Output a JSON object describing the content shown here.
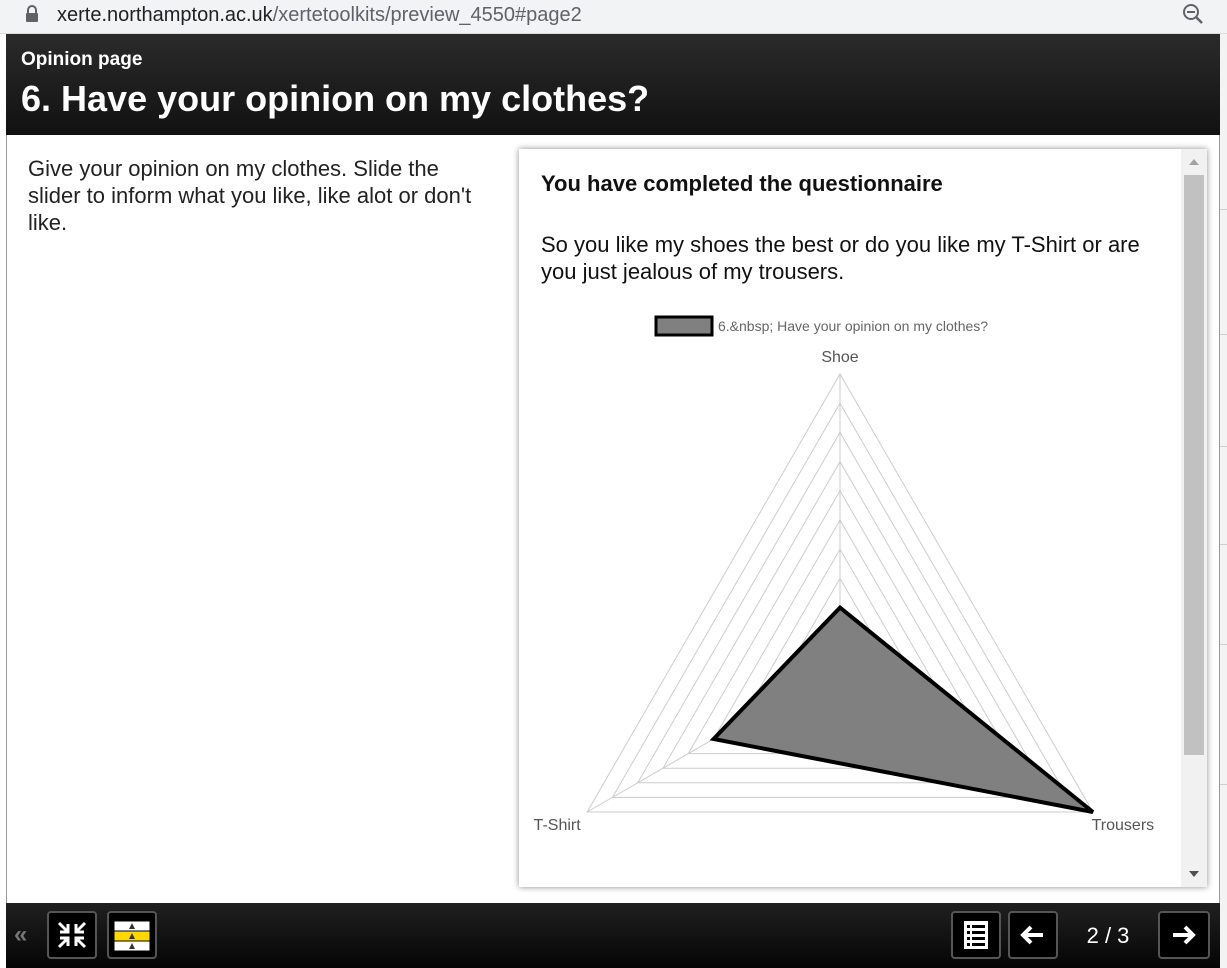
{
  "browser": {
    "url_host": "xerte.northampton.ac.uk",
    "url_path": "/xertetoolkits/preview_4550#page2"
  },
  "header": {
    "page_type": "Opinion page",
    "title": "6.  Have your opinion on my clothes?"
  },
  "instructions": "Give your opinion on my clothes.  Slide the slider to inform what you like, like alot or don't like.",
  "results": {
    "heading": "You have completed the questionnaire",
    "text": "So you like my shoes the best or do you like my T-Shirt or are you just jealous of my trousers."
  },
  "chart_data": {
    "type": "radar",
    "axes": [
      "Shoe",
      "T-Shirt",
      "Trousers"
    ],
    "series": [
      {
        "name": "6.&nbsp; Have your opinion on my clothes?",
        "values": [
          2,
          5,
          10
        ]
      }
    ],
    "range": [
      0,
      10
    ],
    "levels": 10,
    "legend": "top",
    "colors": {
      "fill": "#808080",
      "stroke": "#000000",
      "grid": "#cccccc"
    }
  },
  "footer": {
    "collapse_glyph": "«",
    "page_counter": "2 / 3"
  },
  "icons": {
    "lock": "lock-icon",
    "zoom": "zoom-out-icon",
    "fullscreen": "exit-fullscreen-icon",
    "accessibility": "text-size-icon",
    "toc": "list-icon",
    "prev": "arrow-left-icon",
    "next": "arrow-right-icon"
  }
}
